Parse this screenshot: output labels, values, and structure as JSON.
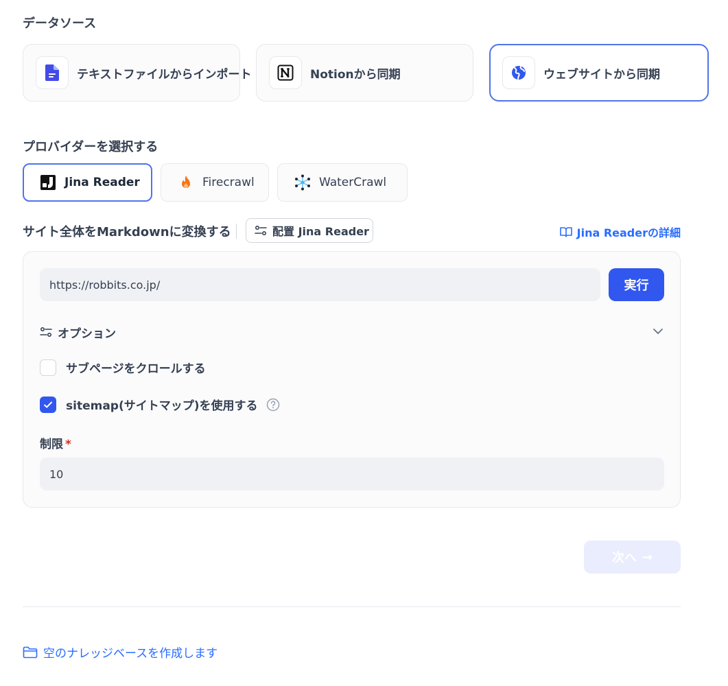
{
  "data_source": {
    "title": "データソース",
    "cards": [
      {
        "label": "テキストファイルからインポート",
        "icon": "file-text-icon",
        "active": false
      },
      {
        "label": "Notionから同期",
        "icon": "notion-icon",
        "active": false
      },
      {
        "label": "ウェブサイトから同期",
        "icon": "globe-icon",
        "active": true
      }
    ]
  },
  "provider": {
    "title": "プロバイダーを選択する",
    "options": [
      {
        "label": "Jina Reader",
        "icon": "jina-logo-icon",
        "active": true
      },
      {
        "label": "Firecrawl",
        "icon": "fire-icon",
        "active": false
      },
      {
        "label": "WaterCrawl",
        "icon": "watercrawl-logo-icon",
        "active": false
      }
    ]
  },
  "convert": {
    "title": "サイト全体をMarkdownに変換する",
    "config_button": "配置 Jina Reader",
    "docs_link": "Jina Readerの詳細"
  },
  "crawl": {
    "url_value": "https://robbits.co.jp/",
    "run_button": "実行",
    "options_label": "オプション",
    "crawl_subpages_label": "サブページをクロールする",
    "crawl_subpages_checked": false,
    "use_sitemap_label": "sitemap(サイトマップ)を使用する",
    "use_sitemap_checked": true,
    "limit_label": "制限",
    "limit_required_mark": "*",
    "limit_value": "10"
  },
  "footer": {
    "next_button": "次へ",
    "next_arrow": "→",
    "empty_kb_link": "空のナレッジベースを作成します"
  },
  "colors": {
    "accent": "#3157ee",
    "link": "#296dff",
    "active_border": "#4f74e8",
    "disabled_button": "#e9edfd"
  }
}
